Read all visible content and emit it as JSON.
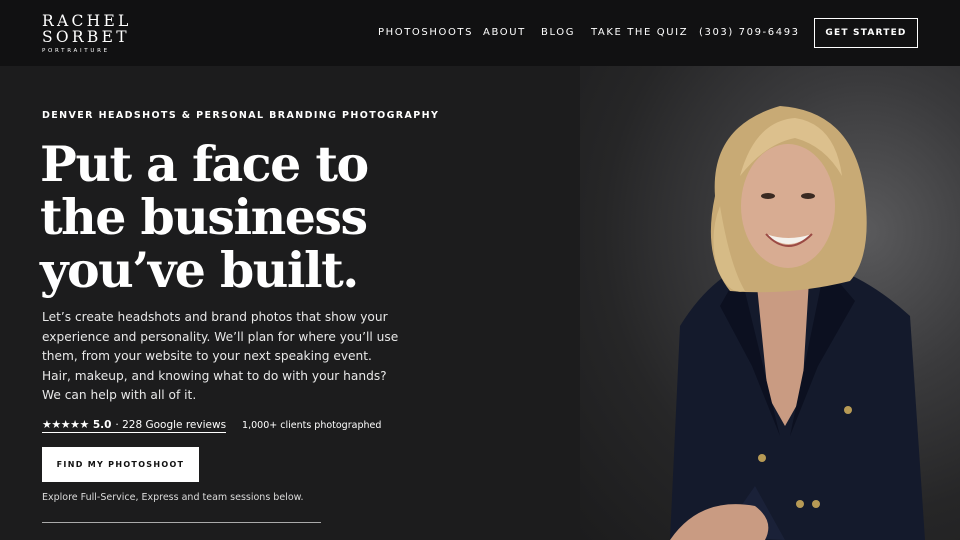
{
  "logo": {
    "line1": "RACHEL",
    "line2": "SORBET",
    "line3": "PORTRAITURE"
  },
  "nav": {
    "links": [
      "PHOTOSHOOTS",
      "ABOUT",
      "BLOG",
      "TAKE THE QUIZ",
      "(303) 709-6493"
    ],
    "cta": "GET STARTED"
  },
  "hero": {
    "eyebrow": "DENVER HEADSHOTS & PERSONAL BRANDING PHOTOGRAPHY",
    "headline": [
      "Put a face to",
      "the business",
      "you’ve built."
    ],
    "body": "Let’s create headshots and brand photos that show your experience and personality. We’ll plan for where you’ll use them, from your website to your next speaking event. Hair, makeup, and knowing what to do with your hands? We can help with all of it.",
    "stars": "★★★★★",
    "rating": "5.0",
    "reviews_text": "· 228 Google reviews",
    "clients": "1,000+ clients photographed",
    "button": "FIND MY PHOTOSHOOT",
    "explore": "Explore Full-Service, Express and team sessions below."
  },
  "colors": {
    "background": "#1c1c1d",
    "nav_background": "#111112",
    "text": "#ffffff"
  }
}
